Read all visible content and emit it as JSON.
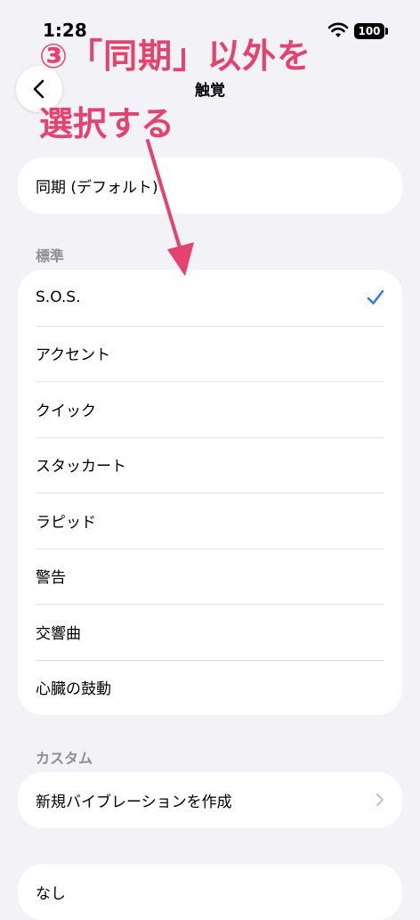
{
  "status_bar": {
    "time": "1:28",
    "battery": "100"
  },
  "nav": {
    "title": "触覚"
  },
  "annotation": {
    "line1": "③「同期」以外を",
    "line2": "選択する"
  },
  "sync_card": {
    "label": "同期 (デフォルト)"
  },
  "standard": {
    "header": "標準",
    "items": [
      {
        "label": "S.O.S.",
        "selected": true
      },
      {
        "label": "アクセント"
      },
      {
        "label": "クイック"
      },
      {
        "label": "スタッカート"
      },
      {
        "label": "ラピッド"
      },
      {
        "label": "警告"
      },
      {
        "label": "交響曲"
      },
      {
        "label": "心臓の鼓動"
      }
    ]
  },
  "custom": {
    "header": "カスタム",
    "create_label": "新規バイブレーションを作成"
  },
  "none_card": {
    "label": "なし"
  },
  "colors": {
    "accent": "#3478f6",
    "annotation": "#e5436e",
    "background": "#f2f2f7"
  }
}
